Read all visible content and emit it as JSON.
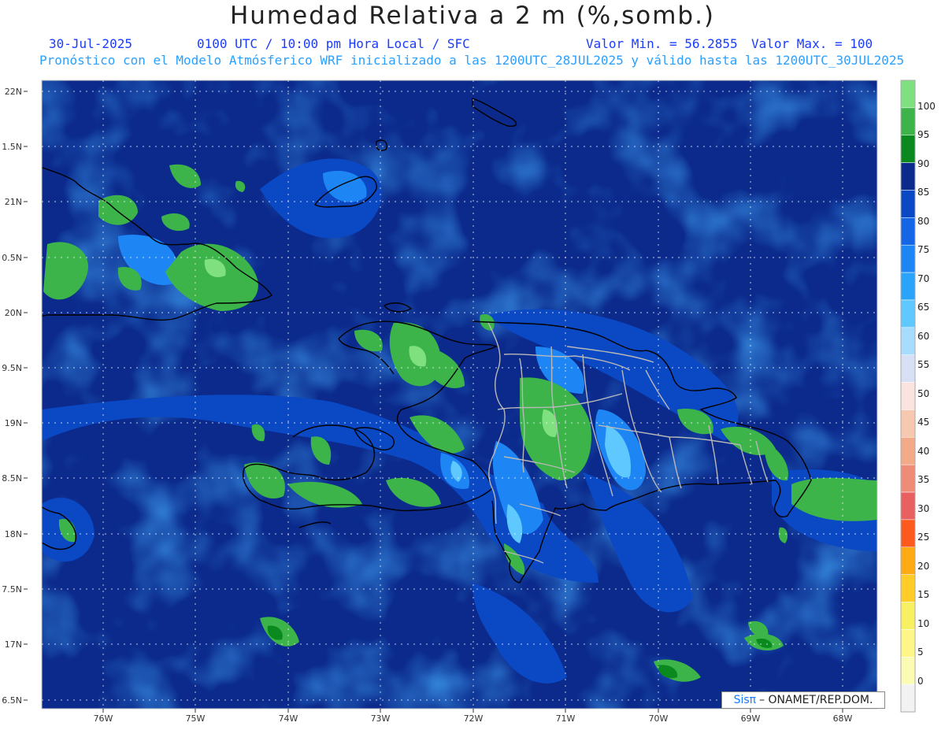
{
  "header": {
    "title": "Humedad Relativa a 2 m (%,somb.)",
    "date": "30-Jul-2025",
    "time": "0100 UTC / 10:00 pm Hora Local / SFC",
    "min": "Valor Min. = 56.2855",
    "max": "Valor Max. = 100",
    "model_line": "Pronóstico con el Modelo Atmósferico WRF inicializado a las 1200UTC_28JUL2025 y válido hasta las  1200UTC_30JUL2025"
  },
  "axes": {
    "lat_labels": [
      "22N",
      "1.5N",
      "21N",
      "0.5N",
      "20N",
      "9.5N",
      "19N",
      "8.5N",
      "18N",
      "7.5N",
      "17N",
      "6.5N"
    ],
    "lon_labels": [
      "76W",
      "75W",
      "74W",
      "73W",
      "72W",
      "71W",
      "70W",
      "69W",
      "68W"
    ]
  },
  "legend": {
    "levels": [
      "100",
      "95",
      "90",
      "85",
      "80",
      "75",
      "70",
      "65",
      "60",
      "55",
      "50",
      "45",
      "40",
      "35",
      "30",
      "25",
      "20",
      "15",
      "10",
      "5",
      "0"
    ],
    "colors": [
      "#7ee07e",
      "#3cb44a",
      "#0a8a1e",
      "#0b2a8c",
      "#0b48c4",
      "#1466e6",
      "#1e86f4",
      "#2aa4fb",
      "#5ec8ff",
      "#a8dcff",
      "#d8e0f6",
      "#fbe4e0",
      "#f6c8b0",
      "#f2aa88",
      "#ee8c78",
      "#e86060",
      "#ff5a1e",
      "#ffaa14",
      "#ffcc28",
      "#f6f062",
      "#fff68a",
      "#fbfbb4",
      "#f2f2f2"
    ]
  },
  "credit": {
    "logo": "Sisπ",
    "text": "– ONAMET/REP.DOM."
  },
  "colors": {
    "ocean": "#0b2a8c",
    "moist": "#0b48c4",
    "land_wet": "#3cb44a",
    "land_moist": "#1466e6",
    "coast": "#000000",
    "border": "#b8b8b8"
  }
}
